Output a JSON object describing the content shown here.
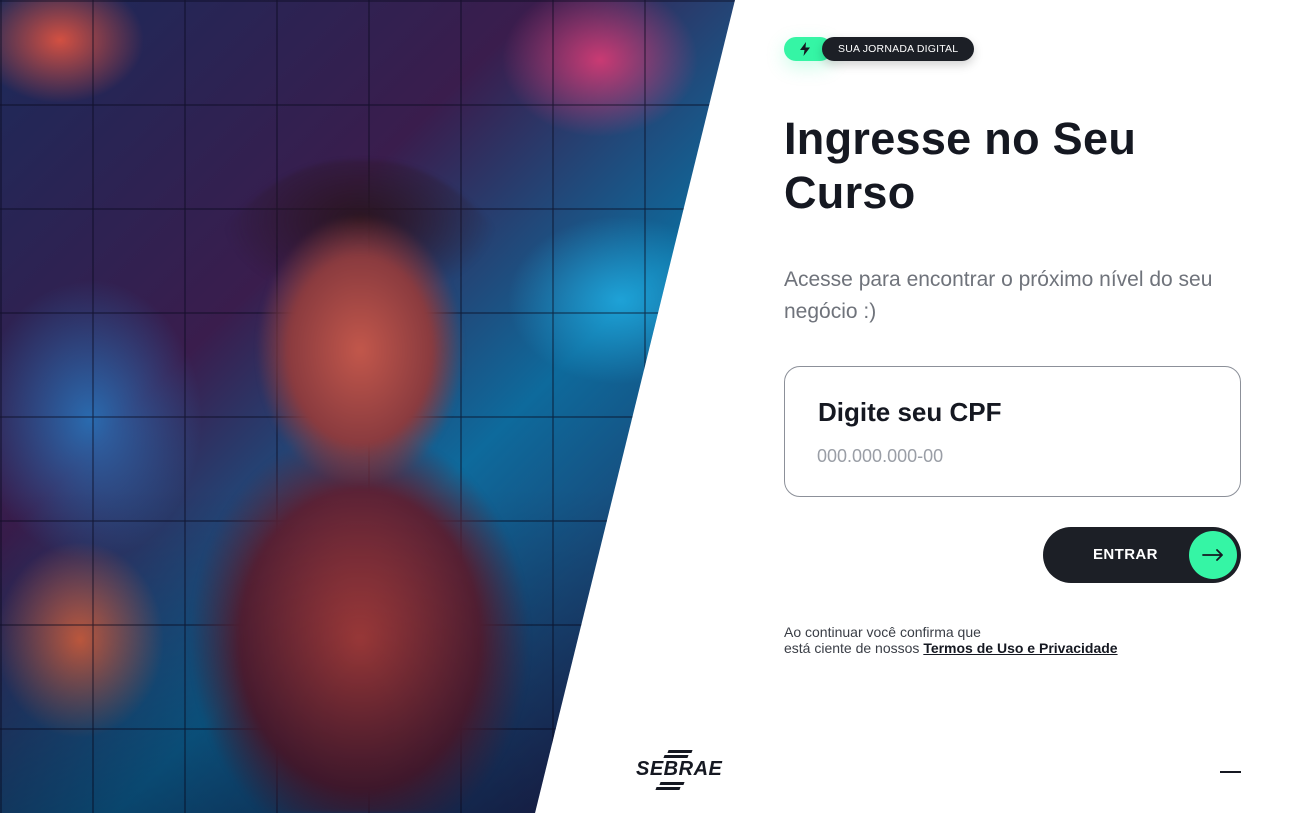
{
  "hero": {
    "image_alt": "Young man wearing headset and glasses in front of a wall of video call participants"
  },
  "badge": {
    "text": "SUA JORNADA DIGITAL",
    "icon": "bolt-icon",
    "accent": "#35f5a5"
  },
  "title": "Ingresse no Seu Curso",
  "subtitle": "Acesse para encontrar o próximo nível do seu negócio :)",
  "cpf": {
    "label": "Digite seu CPF",
    "placeholder": "000.000.000-00",
    "value": ""
  },
  "enter_button": {
    "label": "ENTRAR",
    "icon": "arrow-right-icon"
  },
  "terms": {
    "line1": "Ao continuar você confirma que",
    "line2": "está ciente de nossos",
    "link": "Termos de Uso e Privacidade"
  },
  "logo": {
    "text": "SEBRAE"
  },
  "colors": {
    "dark": "#1c1f26",
    "accent": "#35f5a5",
    "text": "#151821",
    "muted": "#6f737b"
  }
}
